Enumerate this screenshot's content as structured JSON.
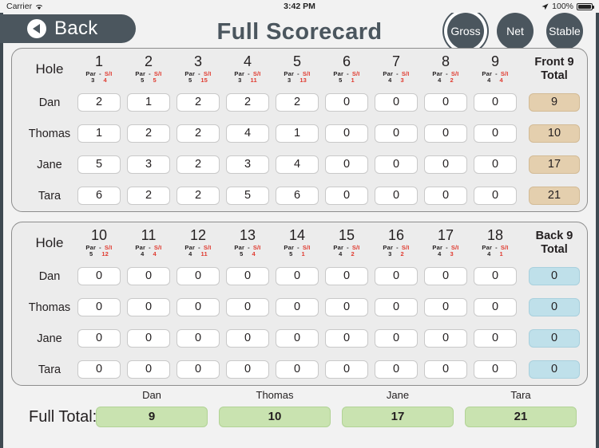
{
  "status_bar": {
    "carrier": "Carrier",
    "wifi_icon": "wifi-icon",
    "time": "3:42 PM",
    "location_icon": "location-arrow-icon",
    "battery_percent": "100%",
    "battery_icon": "battery-icon"
  },
  "header": {
    "back_label": "Back",
    "back_icon": "chevron-left-circle-icon",
    "title": "Full Scorecard",
    "modes": [
      {
        "label": "Gross",
        "selected": true
      },
      {
        "label": "Net",
        "selected": false
      },
      {
        "label": "Stable",
        "selected": false
      }
    ]
  },
  "colors": {
    "header_slate": "#4b565e",
    "front_total_bg": "#e4cfae",
    "back_total_bg": "#bfe0ea",
    "full_total_bg": "#c9e3b0",
    "si_red": "#e03a2f",
    "panel_bg": "#ececec"
  },
  "labels": {
    "hole": "Hole",
    "par": "Par",
    "dash": "-",
    "si": "S/I",
    "front_total": "Front 9\nTotal",
    "front_total_line1": "Front 9",
    "front_total_line2": "Total",
    "back_total_line1": "Back 9",
    "back_total_line2": "Total",
    "full_total": "Full Total:"
  },
  "players": [
    "Dan",
    "Thomas",
    "Jane",
    "Tara"
  ],
  "front_nine": {
    "holes": [
      "1",
      "2",
      "3",
      "4",
      "5",
      "6",
      "7",
      "8",
      "9"
    ],
    "par": [
      "3",
      "5",
      "5",
      "3",
      "3",
      "5",
      "4",
      "4",
      "4"
    ],
    "si": [
      "4",
      "5",
      "15",
      "11",
      "13",
      "1",
      "3",
      "2",
      "4"
    ],
    "scores": [
      {
        "player": "Dan",
        "values": [
          "2",
          "1",
          "2",
          "2",
          "2",
          "0",
          "0",
          "0",
          "0"
        ],
        "total": "9"
      },
      {
        "player": "Thomas",
        "values": [
          "1",
          "2",
          "2",
          "4",
          "1",
          "0",
          "0",
          "0",
          "0"
        ],
        "total": "10"
      },
      {
        "player": "Jane",
        "values": [
          "5",
          "3",
          "2",
          "3",
          "4",
          "0",
          "0",
          "0",
          "0"
        ],
        "total": "17"
      },
      {
        "player": "Tara",
        "values": [
          "6",
          "2",
          "2",
          "5",
          "6",
          "0",
          "0",
          "0",
          "0"
        ],
        "total": "21"
      }
    ]
  },
  "back_nine": {
    "holes": [
      "10",
      "11",
      "12",
      "13",
      "14",
      "15",
      "16",
      "17",
      "18"
    ],
    "par": [
      "5",
      "4",
      "4",
      "5",
      "5",
      "4",
      "3",
      "4",
      "4"
    ],
    "si": [
      "12",
      "4",
      "11",
      "4",
      "1",
      "2",
      "2",
      "3",
      "1"
    ],
    "scores": [
      {
        "player": "Dan",
        "values": [
          "0",
          "0",
          "0",
          "0",
          "0",
          "0",
          "0",
          "0",
          "0"
        ],
        "total": "0"
      },
      {
        "player": "Thomas",
        "values": [
          "0",
          "0",
          "0",
          "0",
          "0",
          "0",
          "0",
          "0",
          "0"
        ],
        "total": "0"
      },
      {
        "player": "Jane",
        "values": [
          "0",
          "0",
          "0",
          "0",
          "0",
          "0",
          "0",
          "0",
          "0"
        ],
        "total": "0"
      },
      {
        "player": "Tara",
        "values": [
          "0",
          "0",
          "0",
          "0",
          "0",
          "0",
          "0",
          "0",
          "0"
        ],
        "total": "0"
      }
    ]
  },
  "full_totals": [
    {
      "player": "Dan",
      "total": "9"
    },
    {
      "player": "Thomas",
      "total": "10"
    },
    {
      "player": "Jane",
      "total": "17"
    },
    {
      "player": "Tara",
      "total": "21"
    }
  ]
}
